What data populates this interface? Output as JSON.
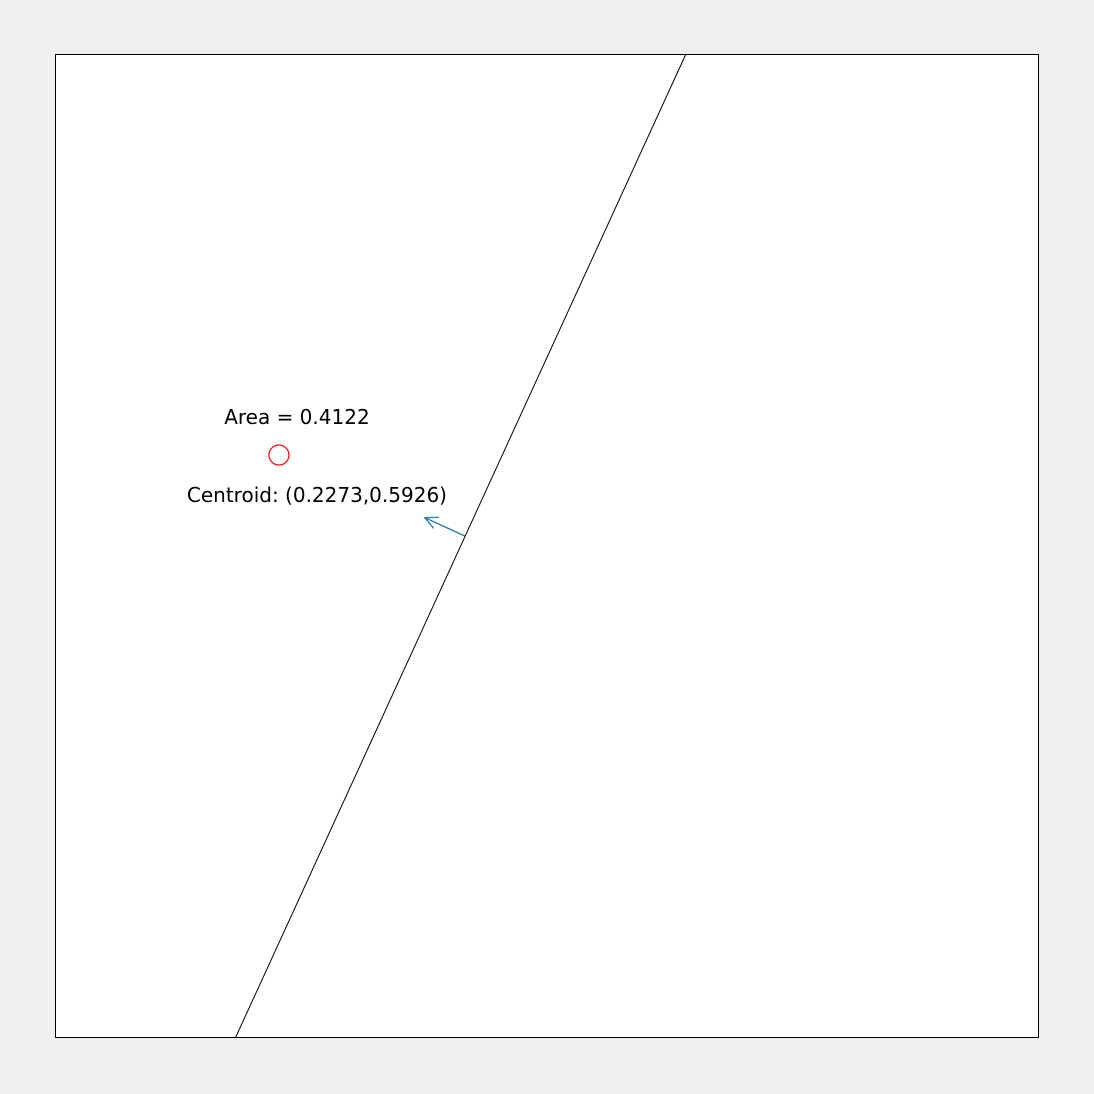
{
  "annotations": {
    "area_label": "Area = 0.4122",
    "centroid_label": "Centroid: (0.2273,0.5926)"
  },
  "geometry": {
    "line_start": [
      0.1832,
      0.0
    ],
    "line_end": [
      0.6411,
      1.0
    ],
    "normal_base": [
      0.4164,
      0.5102
    ],
    "normal_direction": [
      -0.9093,
      0.4164
    ],
    "centroid_marker": [
      0.2273,
      0.5926
    ]
  },
  "colors": {
    "page_background": "#f0f0f0",
    "plot_background": "#ffffff",
    "border": "#000000",
    "line": "#000000",
    "normal_arrow": "#1f7ab4",
    "centroid_marker": "#ff0000"
  }
}
